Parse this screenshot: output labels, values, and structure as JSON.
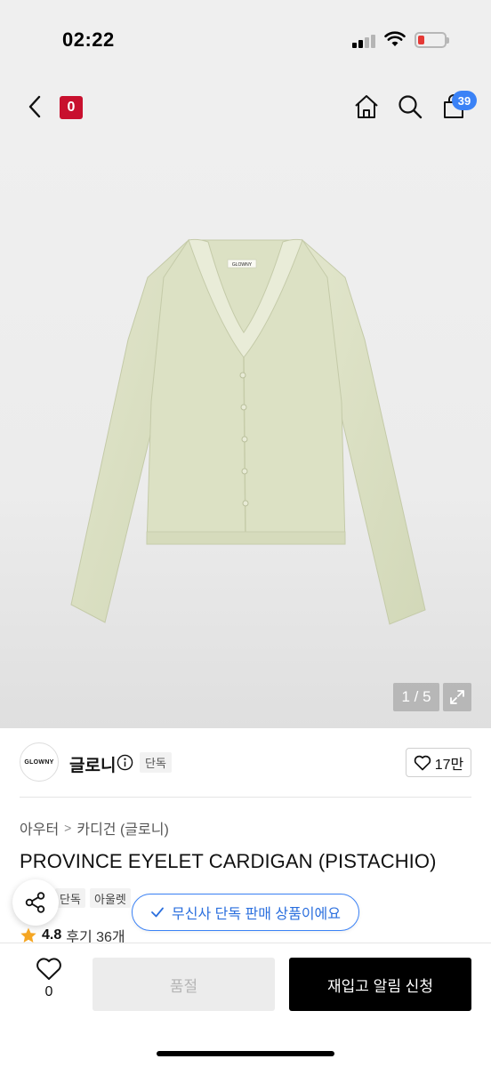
{
  "status_bar": {
    "time": "02:22"
  },
  "nav": {
    "brand_badge": "0",
    "cart_count": "39",
    "icons": [
      "chevron-left-icon",
      "home-icon",
      "search-icon",
      "shopping-bag-icon"
    ]
  },
  "gallery": {
    "counter": "1 / 5",
    "current": 1,
    "total": 5
  },
  "brand": {
    "logo_text": "GLOWNY",
    "name": "글로니",
    "tag": "단독",
    "likes": "17만"
  },
  "breadcrumb": {
    "items": [
      "아우터",
      "카디건 (글로니)"
    ]
  },
  "product": {
    "title": "PROVINCE EYELET CARDIGAN (PISTACHIO)",
    "tags": [
      "단독",
      "아울렛"
    ],
    "exclusive_notice": "무신사 단독 판매 상품이에요",
    "rating": "4.8",
    "review_label": "후기 36개",
    "garment_label": "GLOWNY"
  },
  "bottom_bar": {
    "wish_count": "0",
    "sold_out_label": "품절",
    "restock_label": "재입고 알림 신청"
  },
  "colors": {
    "brand_red": "#c8102e",
    "accent_blue": "#3b82f6",
    "cardigan": "#dde2c6",
    "star": "#f5a623"
  }
}
